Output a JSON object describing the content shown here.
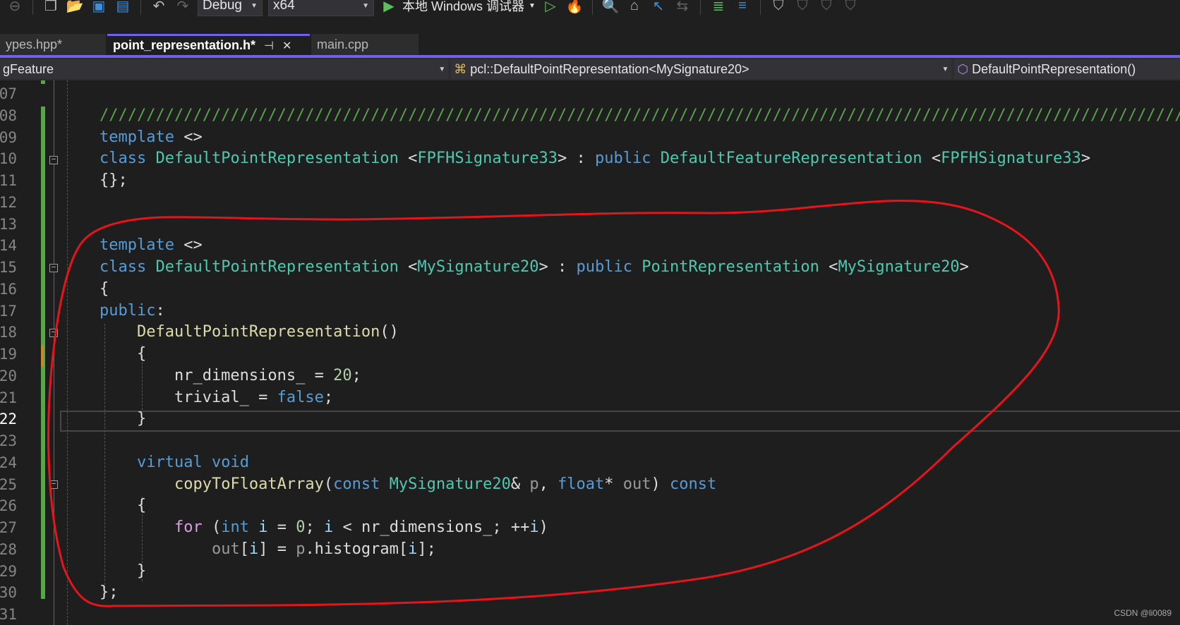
{
  "toolbar": {
    "config": "Debug",
    "platform": "x64",
    "run_label": "本地 Windows 调试器",
    "accent": "#7160e8"
  },
  "tabs": [
    {
      "label": "ypes.hpp*"
    },
    {
      "label": "point_representation.h*"
    },
    {
      "label": "main.cpp"
    }
  ],
  "navbar": {
    "scope": "gFeature",
    "class": "pcl::DefaultPointRepresentation<MySignature20>",
    "member": "DefaultPointRepresentation()"
  },
  "editor": {
    "current_line": "22",
    "lines": [
      {
        "num": "07",
        "tokens": []
      },
      {
        "num": "08",
        "tokens": [
          [
            "///////////////////////////////////////////////////////////////////////////////////////////////////////////////////////",
            "cm"
          ]
        ]
      },
      {
        "num": "09",
        "tokens": [
          [
            "template",
            "kw"
          ],
          [
            " <>",
            "pl"
          ]
        ]
      },
      {
        "num": "10",
        "tokens": [
          [
            "class",
            "kw"
          ],
          [
            " ",
            "pl"
          ],
          [
            "DefaultPointRepresentation",
            "ty"
          ],
          [
            " <",
            "pl"
          ],
          [
            "FPFHSignature33",
            "ty"
          ],
          [
            "> : ",
            "pl"
          ],
          [
            "public",
            "kw"
          ],
          [
            " ",
            "pl"
          ],
          [
            "DefaultFeatureRepresentation",
            "ty"
          ],
          [
            " <",
            "pl"
          ],
          [
            "FPFHSignature33",
            "ty"
          ],
          [
            ">",
            "pl"
          ]
        ]
      },
      {
        "num": "11",
        "tokens": [
          [
            "{};",
            "pl"
          ]
        ]
      },
      {
        "num": "12",
        "tokens": []
      },
      {
        "num": "13",
        "tokens": []
      },
      {
        "num": "14",
        "tokens": [
          [
            "template",
            "kw"
          ],
          [
            " <>",
            "pl"
          ]
        ]
      },
      {
        "num": "15",
        "tokens": [
          [
            "class",
            "kw"
          ],
          [
            " ",
            "pl"
          ],
          [
            "DefaultPointRepresentation",
            "ty"
          ],
          [
            " <",
            "pl"
          ],
          [
            "MySignature20",
            "ty"
          ],
          [
            "> : ",
            "pl"
          ],
          [
            "public",
            "kw"
          ],
          [
            " ",
            "pl"
          ],
          [
            "PointRepresentation",
            "ty"
          ],
          [
            " <",
            "pl"
          ],
          [
            "MySignature20",
            "ty"
          ],
          [
            ">",
            "pl"
          ]
        ]
      },
      {
        "num": "16",
        "tokens": [
          [
            "{",
            "pl"
          ]
        ]
      },
      {
        "num": "17",
        "tokens": [
          [
            "public",
            "kw"
          ],
          [
            ":",
            "pl"
          ]
        ]
      },
      {
        "num": "18",
        "tokens": [
          [
            "    ",
            "pl"
          ],
          [
            "DefaultPointRepresentation",
            "fn"
          ],
          [
            "()",
            "pl"
          ]
        ]
      },
      {
        "num": "19",
        "tokens": [
          [
            "    {",
            "pl"
          ]
        ]
      },
      {
        "num": "20",
        "tokens": [
          [
            "        nr_dimensions_ = ",
            "pl"
          ],
          [
            "20",
            "num"
          ],
          [
            ";",
            "pl"
          ]
        ]
      },
      {
        "num": "21",
        "tokens": [
          [
            "        trivial_ = ",
            "pl"
          ],
          [
            "false",
            "kw"
          ],
          [
            ";",
            "pl"
          ]
        ]
      },
      {
        "num": "22",
        "tokens": [
          [
            "    }",
            "pl"
          ]
        ]
      },
      {
        "num": "23",
        "tokens": []
      },
      {
        "num": "24",
        "tokens": [
          [
            "    ",
            "pl"
          ],
          [
            "virtual",
            "kw"
          ],
          [
            " ",
            "pl"
          ],
          [
            "void",
            "kw"
          ]
        ]
      },
      {
        "num": "25",
        "tokens": [
          [
            "        ",
            "pl"
          ],
          [
            "copyToFloatArray",
            "fn"
          ],
          [
            "(",
            "pl"
          ],
          [
            "const",
            "kw"
          ],
          [
            " ",
            "pl"
          ],
          [
            "MySignature20",
            "ty"
          ],
          [
            "& ",
            "pl"
          ],
          [
            "p",
            "pa"
          ],
          [
            ", ",
            "pl"
          ],
          [
            "float",
            "kw"
          ],
          [
            "* ",
            "pl"
          ],
          [
            "out",
            "pa"
          ],
          [
            ") ",
            "pl"
          ],
          [
            "const",
            "kw"
          ]
        ]
      },
      {
        "num": "26",
        "tokens": [
          [
            "    {",
            "pl"
          ]
        ]
      },
      {
        "num": "27",
        "tokens": [
          [
            "        ",
            "pl"
          ],
          [
            "for",
            "ctl"
          ],
          [
            " (",
            "pl"
          ],
          [
            "int",
            "kw"
          ],
          [
            " ",
            "pl"
          ],
          [
            "i",
            "va"
          ],
          [
            " = ",
            "pl"
          ],
          [
            "0",
            "num"
          ],
          [
            "; ",
            "pl"
          ],
          [
            "i",
            "va"
          ],
          [
            " < nr_dimensions_; ++",
            "pl"
          ],
          [
            "i",
            "va"
          ],
          [
            ")",
            "pl"
          ]
        ]
      },
      {
        "num": "28",
        "tokens": [
          [
            "            ",
            "pl"
          ],
          [
            "out",
            "pa"
          ],
          [
            "[",
            "pl"
          ],
          [
            "i",
            "va"
          ],
          [
            "] = ",
            "pl"
          ],
          [
            "p",
            "pa"
          ],
          [
            ".histogram[",
            "pl"
          ],
          [
            "i",
            "va"
          ],
          [
            "];",
            "pl"
          ]
        ]
      },
      {
        "num": "29",
        "tokens": [
          [
            "    }",
            "pl"
          ]
        ]
      },
      {
        "num": "30",
        "tokens": [
          [
            "};",
            "pl"
          ]
        ]
      },
      {
        "num": "31",
        "tokens": []
      }
    ]
  },
  "annotation_color": "#e8141c",
  "watermark": "CSDN @li0089"
}
